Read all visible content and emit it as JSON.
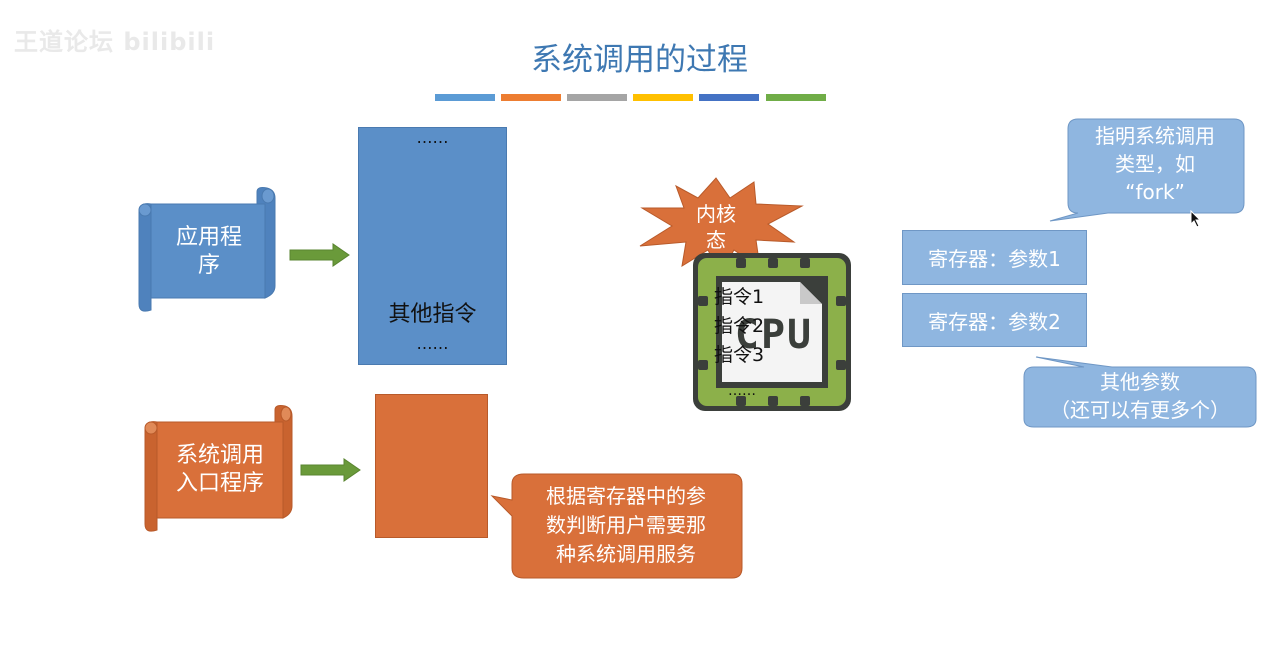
{
  "watermark": "王道论坛 bilibili",
  "title": "系统调用的过程",
  "colors": {
    "title": "#3e78b2",
    "blue": "#5b8fc8",
    "orange": "#d9703a",
    "green_arrow": "#6a9a3a",
    "cpu_green": "#8cb04a",
    "callout_blue": "#8fb6e0",
    "bars": [
      "#5b9bd5",
      "#ed7d31",
      "#a5a5a5",
      "#ffc000",
      "#4472c4",
      "#70ad47"
    ]
  },
  "app_scroll": {
    "label": "应用程序"
  },
  "syscall_scroll": {
    "label": "系统调用\n入口程序"
  },
  "app_block": {
    "top_dots": "……",
    "label": "其他指令",
    "bottom_dots": "……"
  },
  "kernel_burst": {
    "label": "内核\n态"
  },
  "cpu": {
    "chip_text": "CPU",
    "instructions": [
      "指令1",
      "指令2",
      "指令3"
    ],
    "dots": "……"
  },
  "callout_syscall_type": {
    "text": "指明系统调用\n类型，如\n“fork”"
  },
  "registers": [
    "寄存器：参数1",
    "寄存器：参数2"
  ],
  "callout_other_params": {
    "text": "其他参数\n（还可以有更多个）"
  },
  "callout_service": {
    "text": "根据寄存器中的参\n数判断用户需要那\n种系统调用服务"
  }
}
